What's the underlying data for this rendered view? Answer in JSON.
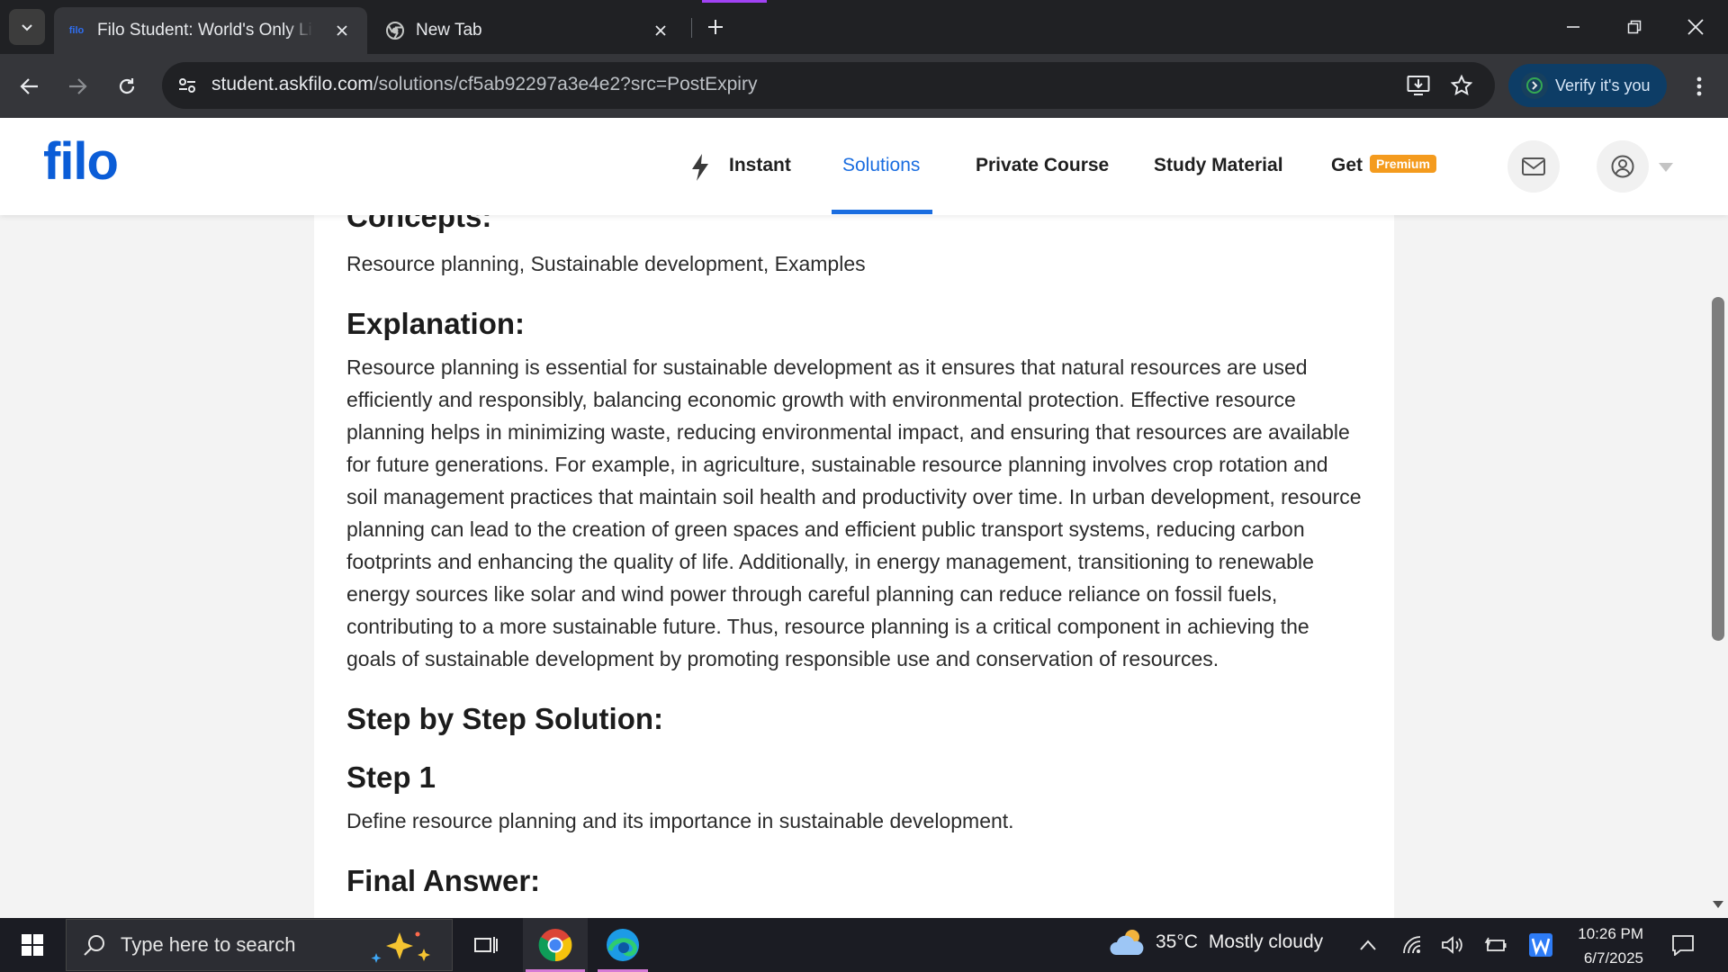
{
  "browser": {
    "tabs": [
      {
        "title": "Filo Student: World's Only Live Instant Tutoring Platform",
        "icon": "filo-favicon",
        "active": true
      },
      {
        "title": "New Tab",
        "icon": "chrome-icon",
        "active": false
      }
    ],
    "url_host": "student.askfilo.com",
    "url_path": "/solutions/cf5ab92297a3e4e2?src=PostExpiry",
    "verify_label": "Verify it's you"
  },
  "site": {
    "logo": "filo",
    "nav": {
      "instant": "Instant",
      "solutions": "Solutions",
      "private_course": "Private Course",
      "study_material": "Study Material",
      "get": "Get",
      "premium": "Premium"
    }
  },
  "solution": {
    "concepts_heading": "Concepts:",
    "concepts_text": "Resource planning, Sustainable development, Examples",
    "explanation_heading": "Explanation:",
    "explanation_text": "Resource planning is essential for sustainable development as it ensures that natural resources are used efficiently and responsibly, balancing economic growth with environmental protection. Effective resource planning helps in minimizing waste, reducing environmental impact, and ensuring that resources are available for future generations. For example, in agriculture, sustainable resource planning involves crop rotation and soil management practices that maintain soil health and productivity over time. In urban development, resource planning can lead to the creation of green spaces and efficient public transport systems, reducing carbon footprints and enhancing the quality of life. Additionally, in energy management, transitioning to renewable energy sources like solar and wind power through careful planning can reduce reliance on fossil fuels, contributing to a more sustainable future. Thus, resource planning is a critical component in achieving the goals of sustainable development by promoting responsible use and conservation of resources.",
    "steps_heading": "Step by Step Solution:",
    "step1_heading": "Step 1",
    "step1_text": "Define resource planning and its importance in sustainable development.",
    "final_heading": "Final Answer:"
  },
  "taskbar": {
    "search_placeholder": "Type here to search",
    "weather_temp": "35°C",
    "weather_desc": "Mostly cloudy",
    "time": "10:26 PM",
    "date": "6/7/2025"
  },
  "colors": {
    "accent": "#1a6de0",
    "premium": "#f49b1e",
    "logo": "#0b5dd7"
  }
}
